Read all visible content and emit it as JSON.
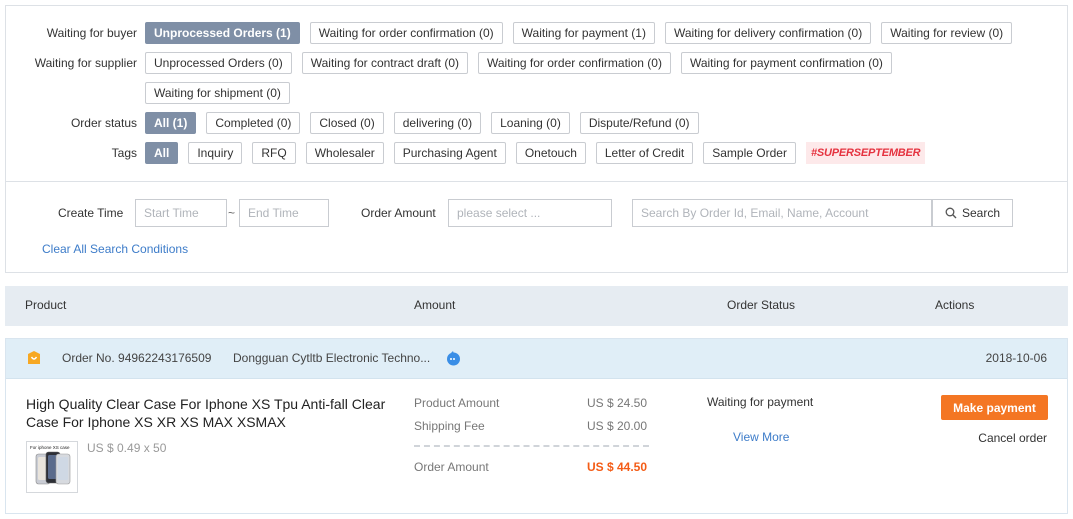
{
  "filters": {
    "buyer": {
      "label": "Waiting for buyer",
      "chips": [
        "Unprocessed Orders (1)",
        "Waiting for order confirmation (0)",
        "Waiting for payment (1)",
        "Waiting for delivery confirmation (0)",
        "Waiting for review (0)"
      ]
    },
    "supplier": {
      "label": "Waiting for supplier",
      "chips": [
        "Unprocessed Orders (0)",
        "Waiting for contract draft (0)",
        "Waiting for order confirmation (0)",
        "Waiting for payment confirmation (0)"
      ],
      "chips_row2": [
        "Waiting for shipment (0)"
      ]
    },
    "status": {
      "label": "Order status",
      "chips": [
        "All (1)",
        "Completed (0)",
        "Closed (0)",
        "delivering (0)",
        "Loaning (0)",
        "Dispute/Refund (0)"
      ]
    },
    "tags": {
      "label": "Tags",
      "chips": [
        "All",
        "Inquiry",
        "RFQ",
        "Wholesaler",
        "Purchasing Agent",
        "Onetouch",
        "Letter of Credit",
        "Sample Order"
      ],
      "promo": "#SUPERSEPTEMBER"
    }
  },
  "search": {
    "create_time_label": "Create Time",
    "start_placeholder": "Start Time",
    "tilde": "~",
    "end_placeholder": "End Time",
    "order_amount_label": "Order Amount",
    "amount_placeholder": "please select ...",
    "keyword_placeholder": "Search By Order Id, Email, Name, Account",
    "search_button": "Search",
    "clear_link": "Clear All Search Conditions"
  },
  "table_header": {
    "product": "Product",
    "amount": "Amount",
    "order_status": "Order Status",
    "actions": "Actions"
  },
  "order": {
    "order_no": "Order No. 94962243176509",
    "supplier": "Dongguan Cytltb Electronic Techno...",
    "date": "2018-10-06",
    "product_title": "High Quality Clear Case For Iphone XS Tpu Anti-fall Clear Case For Iphone XS XR XS MAX XSMAX",
    "thumb_caption": "For iphone XS case",
    "unit_price": "US $ 0.49 x 50",
    "product_amount_label": "Product Amount",
    "product_amount": "US $ 24.50",
    "shipping_fee_label": "Shipping Fee",
    "shipping_fee": "US $ 20.00",
    "order_amount_label": "Order Amount",
    "order_amount": "US $ 44.50",
    "status": "Waiting for payment",
    "view_more": "View More",
    "pay_button": "Make payment",
    "cancel": "Cancel order"
  },
  "colors": {
    "active_chip": "#7f8fa6",
    "link": "#3d7cc9",
    "accent_orange": "#f47623",
    "total_orange": "#f45c16",
    "promo_red": "#e5323f",
    "table_header_bg": "#e6ecf2",
    "order_header_bg": "#e0eef7"
  }
}
